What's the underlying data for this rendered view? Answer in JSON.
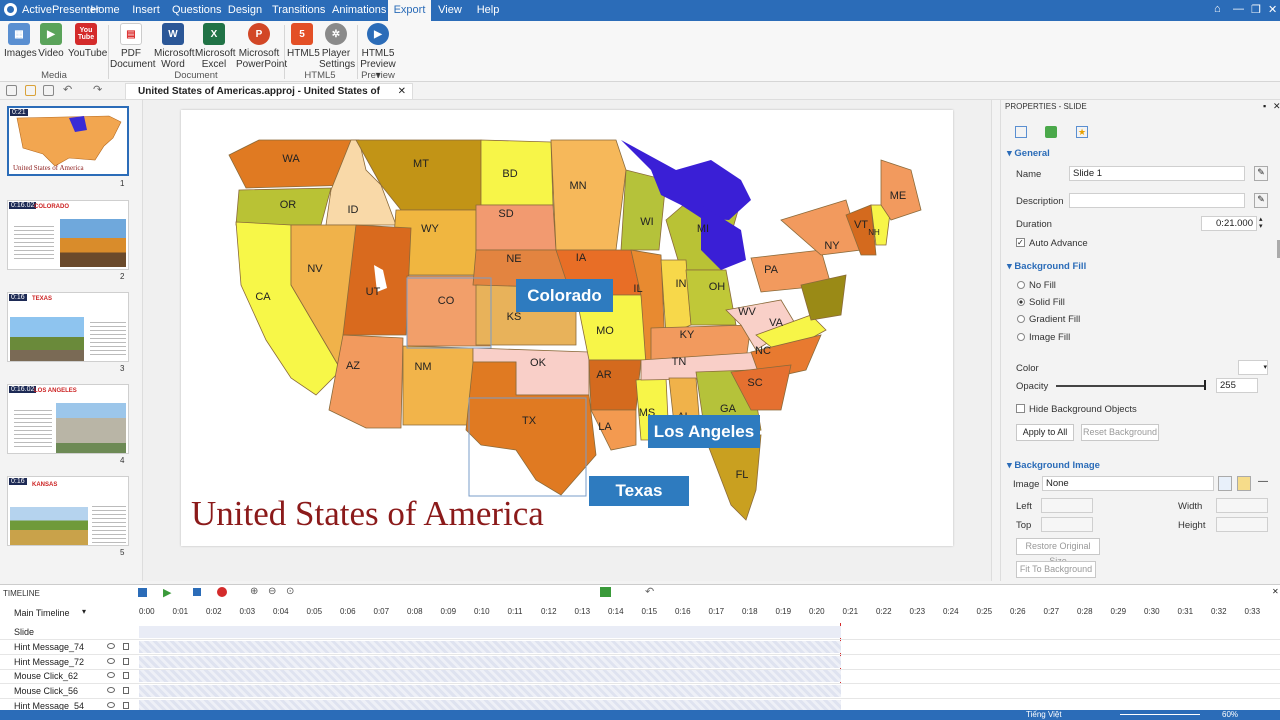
{
  "app": {
    "title": "ActivePresenter"
  },
  "menu": {
    "tabs": [
      "Home",
      "Insert",
      "Questions",
      "Design",
      "Transitions",
      "Animations",
      "Export",
      "View",
      "Help"
    ],
    "active": "Export"
  },
  "ribbon": {
    "buttons": [
      {
        "l1": "Images",
        "l2": ""
      },
      {
        "l1": "Video",
        "l2": ""
      },
      {
        "l1": "YouTube",
        "l2": ""
      },
      {
        "l1": "PDF",
        "l2": "Document"
      },
      {
        "l1": "Microsoft",
        "l2": "Word"
      },
      {
        "l1": "Microsoft",
        "l2": "Excel"
      },
      {
        "l1": "Microsoft",
        "l2": "PowerPoint"
      },
      {
        "l1": "HTML5",
        "l2": ""
      },
      {
        "l1": "Player",
        "l2": "Settings"
      },
      {
        "l1": "HTML5",
        "l2": "Preview ▾"
      }
    ],
    "groups": [
      "Media",
      "Document",
      "HTML5",
      "Preview"
    ],
    "icon_glyphs": {
      "youtube": "You Tube",
      "word": "W",
      "excel": "X",
      "powerpoint": "P",
      "html5": "5"
    }
  },
  "document_tab": {
    "title": "United States of Americas.approj - United States of America.approj"
  },
  "slides": [
    {
      "time": "0:21",
      "num": "1",
      "title": "United States of America"
    },
    {
      "time": "0:16.02",
      "num": "2",
      "title": "COLORADO"
    },
    {
      "time": "0:16",
      "num": "3",
      "title": "TEXAS"
    },
    {
      "time": "0:16.02",
      "num": "4",
      "title": "LOS ANGELES"
    },
    {
      "time": "0:16",
      "num": "5",
      "title": "KANSAS"
    }
  ],
  "canvas": {
    "title": "United States of America",
    "callouts": {
      "colorado": "Colorado",
      "los_angeles": "Los Angeles",
      "texas": "Texas"
    },
    "states": {
      "WA": "WA",
      "OR": "OR",
      "CA": "CA",
      "ID": "ID",
      "NV": "NV",
      "MT": "MT",
      "WY": "WY",
      "UT": "UT",
      "AZ": "AZ",
      "CO": "CO",
      "NM": "NM",
      "BD": "BD",
      "SD": "SD",
      "NE": "NE",
      "KS": "KS",
      "OK": "OK",
      "TX": "TX",
      "MN": "MN",
      "IA": "IA",
      "MO": "MO",
      "AR": "AR",
      "LA": "LA",
      "WI": "WI",
      "IL": "IL",
      "MS": "MS",
      "MI": "MI",
      "IN": "IN",
      "KY": "KY",
      "TN": "TN",
      "AL": "AL",
      "GA": "GA",
      "FL": "FL",
      "OH": "OH",
      "WV": "WV",
      "VA": "VA",
      "NC": "NC",
      "SC": "SC",
      "PA": "PA",
      "NY": "NY",
      "VT": "VT",
      "NH": "NH",
      "ME": "ME"
    }
  },
  "properties": {
    "header": "PROPERTIES - SLIDE",
    "general": "General",
    "name_label": "Name",
    "name_value": "Slide 1",
    "description_label": "Description",
    "description_value": "",
    "duration_label": "Duration",
    "duration_value": "0:21.000",
    "auto_advance": "Auto Advance",
    "bg_fill": "Background Fill",
    "no_fill": "No Fill",
    "solid_fill": "Solid Fill",
    "gradient_fill": "Gradient Fill",
    "image_fill": "Image Fill",
    "color_label": "Color",
    "opacity_label": "Opacity",
    "opacity_value": "255",
    "opacity_level": 1.0,
    "hide_bg": "Hide Background Objects",
    "apply_all": "Apply to All",
    "reset_bg": "Reset Background",
    "bg_image": "Background Image",
    "image_label": "Image",
    "image_value": "None",
    "left": "Left",
    "width": "Width",
    "top": "Top",
    "height": "Height",
    "restore": "Restore Original Size",
    "fit": "Fit To Background"
  },
  "timeline": {
    "header": "TIMELINE",
    "main": "Main Timeline",
    "ruler": [
      "0:00",
      "0:01",
      "0:02",
      "0:03",
      "0:04",
      "0:05",
      "0:06",
      "0:07",
      "0:08",
      "0:09",
      "0:10",
      "0:11",
      "0:12",
      "0:13",
      "0:14",
      "0:15",
      "0:16",
      "0:17",
      "0:18",
      "0:19",
      "0:20",
      "0:21",
      "0:22",
      "0:23",
      "0:24",
      "0:25",
      "0:26",
      "0:27",
      "0:28",
      "0:29",
      "0:30",
      "0:31",
      "0:32",
      "0:33"
    ],
    "rows": [
      "Slide",
      "Hint Message_74",
      "Hint Message_72",
      "Mouse Click_62",
      "Mouse Click_56",
      "Hint Message_54"
    ]
  },
  "status": {
    "language": "Tiếng Việt",
    "zoom": "60%"
  },
  "colors": {
    "accent": "#2b6cb8",
    "callout": "#2e7bbf"
  }
}
